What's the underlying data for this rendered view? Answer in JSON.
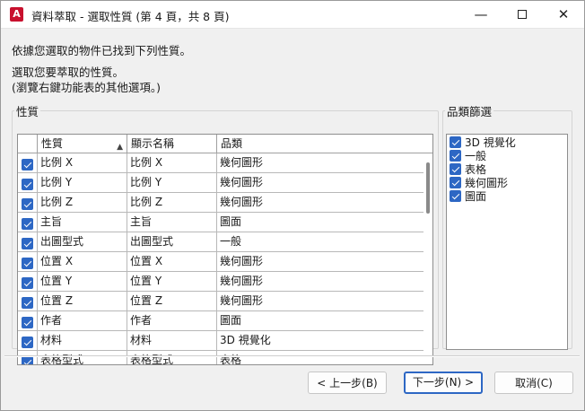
{
  "window": {
    "title": "資料萃取 - 選取性質 (第 4 頁，共 8 頁)",
    "app_icon_letter": "A",
    "app_icon_color": "#c8102e",
    "minimize_glyph": "—",
    "close_glyph": "✕"
  },
  "instructions": {
    "line1": "依據您選取的物件已找到下列性質。",
    "line2": "選取您要萃取的性質。",
    "line3": "(瀏覽右鍵功能表的其他選項。)"
  },
  "properties_group": {
    "legend": "性質",
    "columns": [
      "性質",
      "顯示名稱",
      "品類"
    ],
    "sorted_column": "性質",
    "sort_direction": "ascending",
    "rows": [
      {
        "checked": true,
        "property": "比例 X",
        "display_name": "比例 X",
        "category": "幾何圖形"
      },
      {
        "checked": true,
        "property": "比例 Y",
        "display_name": "比例 Y",
        "category": "幾何圖形"
      },
      {
        "checked": true,
        "property": "比例 Z",
        "display_name": "比例 Z",
        "category": "幾何圖形"
      },
      {
        "checked": true,
        "property": "主旨",
        "display_name": "主旨",
        "category": "圖面"
      },
      {
        "checked": true,
        "property": "出圖型式",
        "display_name": "出圖型式",
        "category": "一般"
      },
      {
        "checked": true,
        "property": "位置 X",
        "display_name": "位置 X",
        "category": "幾何圖形"
      },
      {
        "checked": true,
        "property": "位置 Y",
        "display_name": "位置 Y",
        "category": "幾何圖形"
      },
      {
        "checked": true,
        "property": "位置 Z",
        "display_name": "位置 Z",
        "category": "幾何圖形"
      },
      {
        "checked": true,
        "property": "作者",
        "display_name": "作者",
        "category": "圖面"
      },
      {
        "checked": true,
        "property": "材料",
        "display_name": "材料",
        "category": "3D 視覺化"
      },
      {
        "checked": true,
        "property": "表格型式",
        "display_name": "表格型式",
        "category": "表格"
      }
    ]
  },
  "category_filter": {
    "legend": "品類篩選",
    "items": [
      {
        "label": "3D 視覺化",
        "checked": true
      },
      {
        "label": "一般",
        "checked": true
      },
      {
        "label": "表格",
        "checked": true
      },
      {
        "label": "幾何圖形",
        "checked": true
      },
      {
        "label": "圖面",
        "checked": true
      }
    ]
  },
  "buttons": {
    "back": "< 上一步(B)",
    "next": "下一步(N) >",
    "cancel": "取消(C)"
  },
  "colors": {
    "accent": "#2d67c4",
    "dialog_background": "#f0f0f0"
  }
}
